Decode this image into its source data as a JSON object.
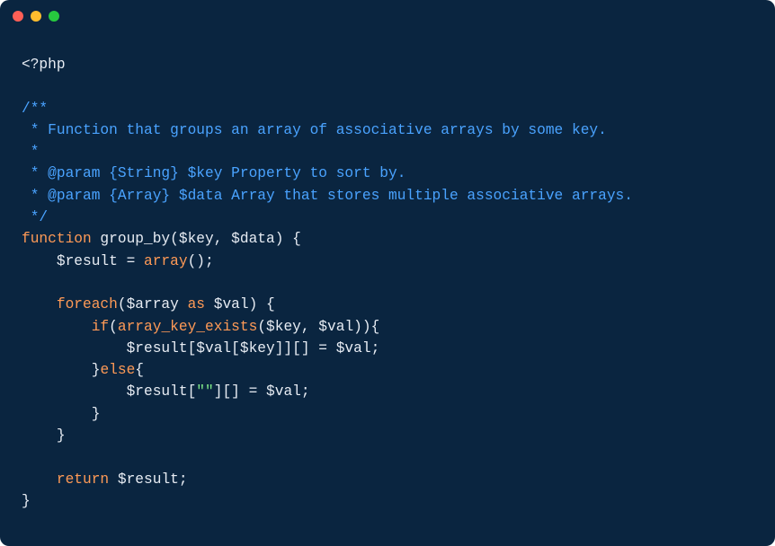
{
  "code": {
    "lines": [
      {
        "segments": [
          {
            "cls": "c-default",
            "text": "<?php"
          }
        ]
      },
      {
        "segments": [
          {
            "cls": "c-default",
            "text": ""
          }
        ]
      },
      {
        "segments": [
          {
            "cls": "c-comment",
            "text": "/**"
          }
        ]
      },
      {
        "segments": [
          {
            "cls": "c-comment",
            "text": " * Function that groups an array of associative arrays by some key."
          }
        ]
      },
      {
        "segments": [
          {
            "cls": "c-comment",
            "text": " *"
          }
        ]
      },
      {
        "segments": [
          {
            "cls": "c-comment",
            "text": " * @param {String} $key Property to sort by."
          }
        ]
      },
      {
        "segments": [
          {
            "cls": "c-comment",
            "text": " * @param {Array} $data Array that stores multiple associative arrays."
          }
        ]
      },
      {
        "segments": [
          {
            "cls": "c-comment",
            "text": " */"
          }
        ]
      },
      {
        "segments": [
          {
            "cls": "c-keyword",
            "text": "function"
          },
          {
            "cls": "c-default",
            "text": " group_by($key, $data) {"
          }
        ]
      },
      {
        "segments": [
          {
            "cls": "c-default",
            "text": "    $result = "
          },
          {
            "cls": "c-keyword",
            "text": "array"
          },
          {
            "cls": "c-default",
            "text": "();"
          }
        ]
      },
      {
        "segments": [
          {
            "cls": "c-default",
            "text": ""
          }
        ]
      },
      {
        "segments": [
          {
            "cls": "c-default",
            "text": "    "
          },
          {
            "cls": "c-keyword",
            "text": "foreach"
          },
          {
            "cls": "c-default",
            "text": "($array "
          },
          {
            "cls": "c-keyword",
            "text": "as"
          },
          {
            "cls": "c-default",
            "text": " $val) {"
          }
        ]
      },
      {
        "segments": [
          {
            "cls": "c-default",
            "text": "        "
          },
          {
            "cls": "c-keyword",
            "text": "if"
          },
          {
            "cls": "c-default",
            "text": "("
          },
          {
            "cls": "c-keyword",
            "text": "array_key_exists"
          },
          {
            "cls": "c-default",
            "text": "($key, $val)){"
          }
        ]
      },
      {
        "segments": [
          {
            "cls": "c-default",
            "text": "            $result[$val[$key]][] = $val;"
          }
        ]
      },
      {
        "segments": [
          {
            "cls": "c-default",
            "text": "        }"
          },
          {
            "cls": "c-keyword",
            "text": "else"
          },
          {
            "cls": "c-default",
            "text": "{"
          }
        ]
      },
      {
        "segments": [
          {
            "cls": "c-default",
            "text": "            $result["
          },
          {
            "cls": "c-string",
            "text": "\"\""
          },
          {
            "cls": "c-default",
            "text": "][] = $val;"
          }
        ]
      },
      {
        "segments": [
          {
            "cls": "c-default",
            "text": "        }"
          }
        ]
      },
      {
        "segments": [
          {
            "cls": "c-default",
            "text": "    }"
          }
        ]
      },
      {
        "segments": [
          {
            "cls": "c-default",
            "text": ""
          }
        ]
      },
      {
        "segments": [
          {
            "cls": "c-default",
            "text": "    "
          },
          {
            "cls": "c-keyword",
            "text": "return"
          },
          {
            "cls": "c-default",
            "text": " $result;"
          }
        ]
      },
      {
        "segments": [
          {
            "cls": "c-default",
            "text": "}"
          }
        ]
      }
    ]
  }
}
